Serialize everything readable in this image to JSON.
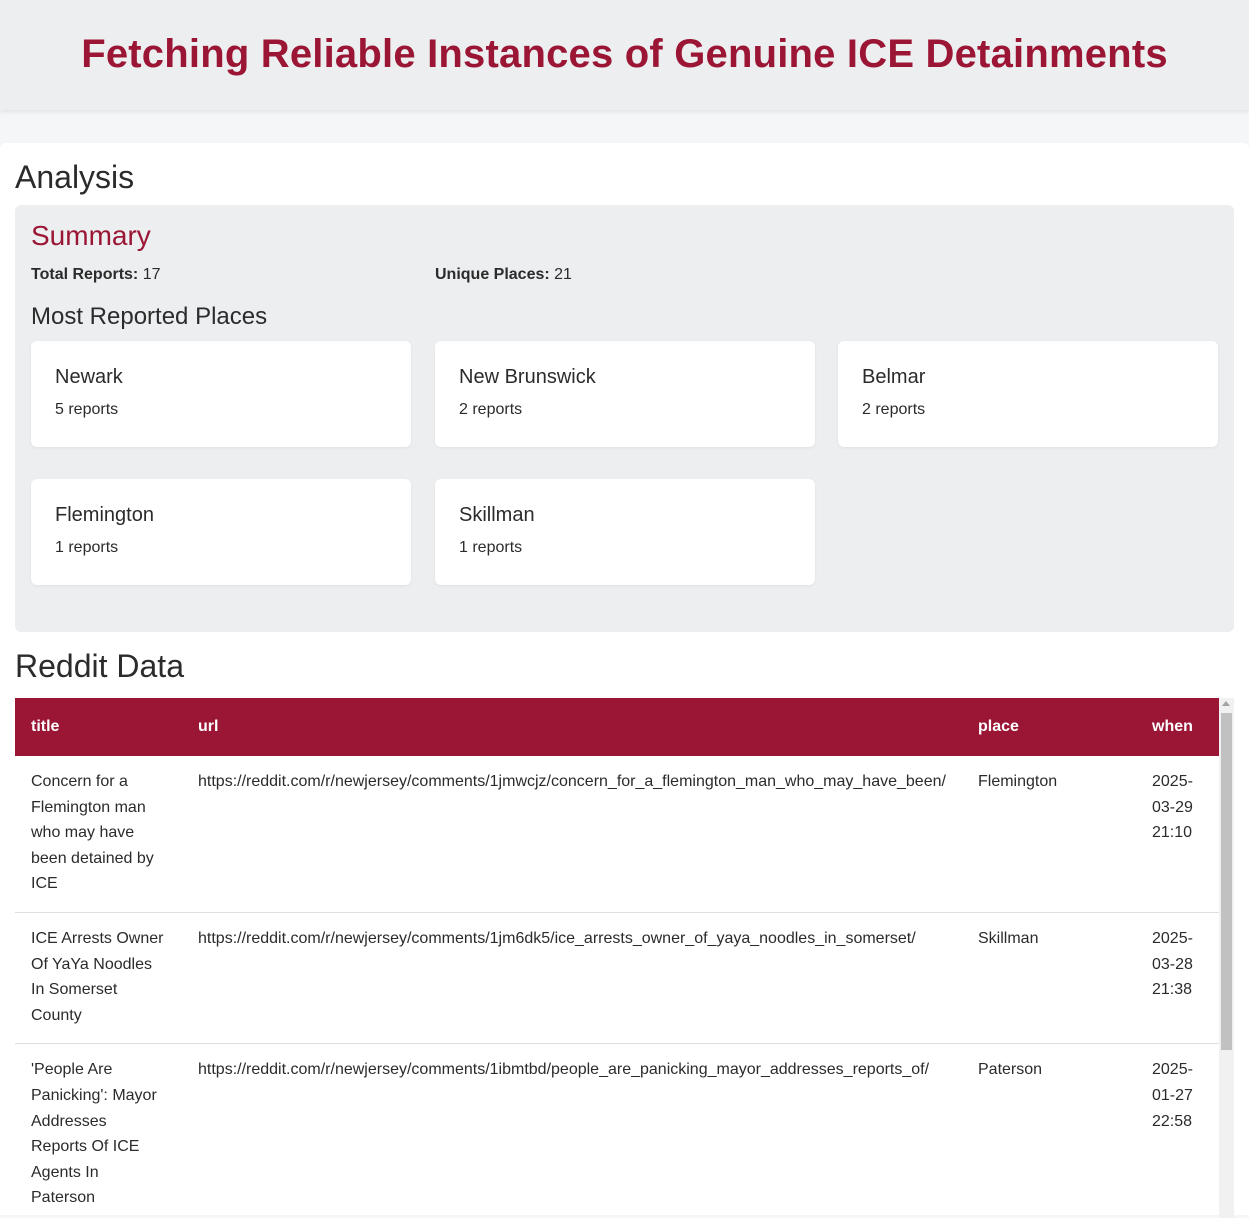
{
  "header": {
    "title": "Fetching Reliable Instances of Genuine ICE Detainments"
  },
  "analysis": {
    "title": "Analysis",
    "summary": {
      "title": "Summary",
      "total_reports_label": "Total Reports:",
      "total_reports_value": "17",
      "unique_places_label": "Unique Places:",
      "unique_places_value": "21"
    },
    "most_reported": {
      "title": "Most Reported Places",
      "places": [
        {
          "name": "Newark",
          "count": "5 reports"
        },
        {
          "name": "New Brunswick",
          "count": "2 reports"
        },
        {
          "name": "Belmar",
          "count": "2 reports"
        },
        {
          "name": "Flemington",
          "count": "1 reports"
        },
        {
          "name": "Skillman",
          "count": "1 reports"
        }
      ]
    }
  },
  "reddit": {
    "title": "Reddit Data",
    "columns": [
      "title",
      "url",
      "place",
      "when"
    ],
    "rows": [
      {
        "title": "Concern for a Flemington man who may have been detained by ICE",
        "url": "https://reddit.com/r/newjersey/comments/1jmwcjz/concern_for_a_flemington_man_who_may_have_been/",
        "place": "Flemington",
        "when": "2025-03-29 21:10"
      },
      {
        "title": "ICE Arrests Owner Of YaYa Noodles In Somerset County",
        "url": "https://reddit.com/r/newjersey/comments/1jm6dk5/ice_arrests_owner_of_yaya_noodles_in_somerset/",
        "place": "Skillman",
        "when": "2025-03-28 21:38"
      },
      {
        "title": "'People Are Panicking': Mayor Addresses Reports Of ICE Agents In Paterson",
        "url": "https://reddit.com/r/newjersey/comments/1ibmtbd/people_are_panicking_mayor_addresses_reports_of/",
        "place": "Paterson",
        "when": "2025-01-27 22:58"
      }
    ]
  }
}
